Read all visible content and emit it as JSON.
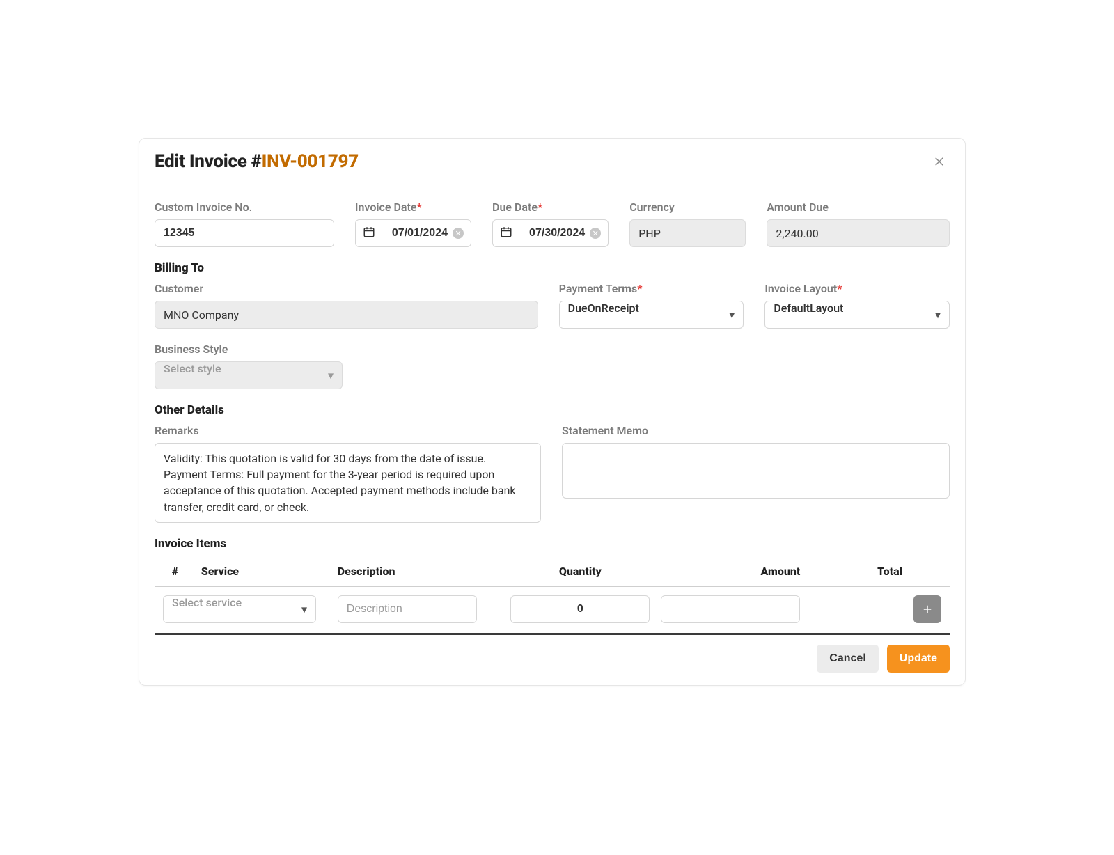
{
  "colors": {
    "accent": "#C26B00",
    "primaryBtn": "#F6921E"
  },
  "header": {
    "title_prefix": "Edit Invoice #",
    "invoice_number": "INV-001797"
  },
  "fields": {
    "custom_invoice_no": {
      "label": "Custom Invoice No.",
      "value": "12345"
    },
    "invoice_date": {
      "label": "Invoice Date",
      "value": "07/01/2024",
      "required": true
    },
    "due_date": {
      "label": "Due Date",
      "value": "07/30/2024",
      "required": true
    },
    "currency": {
      "label": "Currency",
      "value": "PHP"
    },
    "amount_due": {
      "label": "Amount Due",
      "value": "2,240.00"
    }
  },
  "billing": {
    "section": "Billing To",
    "customer": {
      "label": "Customer",
      "value": "MNO Company"
    },
    "payment_terms": {
      "label": "Payment Terms",
      "value": "DueOnReceipt",
      "required": true
    },
    "invoice_layout": {
      "label": "Invoice Layout",
      "value": "DefaultLayout",
      "required": true
    },
    "business_style": {
      "label": "Business Style",
      "placeholder": "Select style"
    }
  },
  "other": {
    "section": "Other Details",
    "remarks": {
      "label": "Remarks",
      "value": "Validity: This quotation is valid for 30 days from the date of issue. Payment Terms: Full payment for the 3-year period is required upon acceptance of this quotation. Accepted payment methods include bank transfer, credit card, or check."
    },
    "statement_memo": {
      "label": "Statement Memo",
      "value": ""
    }
  },
  "items": {
    "section": "Invoice Items",
    "columns": {
      "idx": "#",
      "service": "Service",
      "description": "Description",
      "quantity": "Quantity",
      "amount": "Amount",
      "total": "Total"
    },
    "row": {
      "service_placeholder": "Select service",
      "description_placeholder": "Description",
      "quantity": "0",
      "amount": "",
      "total": ""
    }
  },
  "footer": {
    "cancel": "Cancel",
    "update": "Update"
  }
}
